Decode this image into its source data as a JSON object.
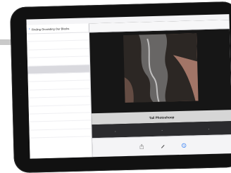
{
  "sidebar": {
    "title": "Finding Grounding Our Blocks",
    "items": [
      {
        "label": "",
        "selected": false
      },
      {
        "label": "",
        "selected": false
      },
      {
        "label": "",
        "selected": false
      },
      {
        "label": "",
        "selected": false
      },
      {
        "label": "",
        "selected": true
      },
      {
        "label": "",
        "selected": false
      },
      {
        "label": "",
        "selected": false
      },
      {
        "label": "",
        "selected": false
      },
      {
        "label": "",
        "selected": false
      },
      {
        "label": "",
        "selected": false
      },
      {
        "label": "",
        "selected": false
      },
      {
        "label": "",
        "selected": false
      },
      {
        "label": "",
        "selected": false
      }
    ]
  },
  "main": {
    "header_title": "",
    "caption": "Tail Photoshoop"
  },
  "colors": {
    "accent": "#2f7cf6",
    "selected_row": "#d9d9de",
    "caption_bar": "#d6d6d6"
  },
  "icons": {
    "back": "chevron-left-icon",
    "toolbar": [
      "share-icon",
      "pen-icon",
      "info-icon"
    ]
  }
}
